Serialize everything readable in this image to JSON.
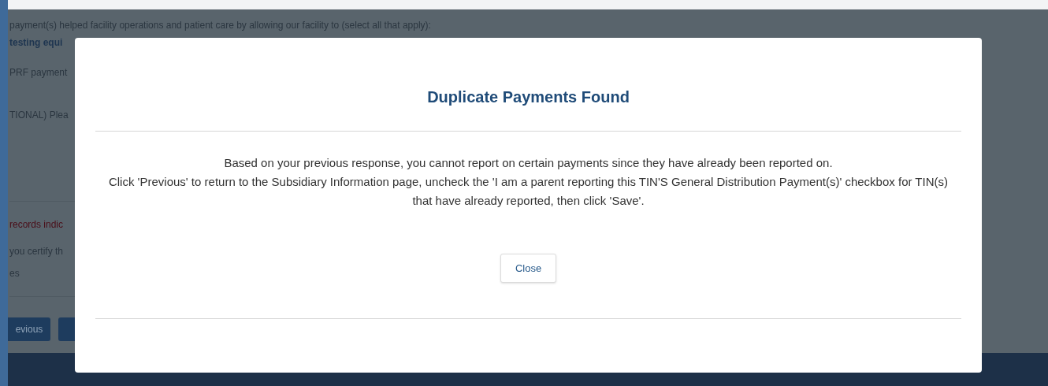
{
  "background_page": {
    "question": "payment(s) helped facility operations and patient care by allowing our facility to (select all that apply):",
    "selected_option": "testing equi",
    "lines": [
      {
        "kind": "plain",
        "text": "PRF payment"
      },
      {
        "kind": "plain",
        "text": "TIONAL) Plea"
      },
      {
        "kind": "rule"
      },
      {
        "kind": "warning",
        "text": "records indic"
      },
      {
        "kind": "plain",
        "text": "you certify th"
      },
      {
        "kind": "plain",
        "text": "es"
      }
    ],
    "previous_button": "evious"
  },
  "modal": {
    "title": "Duplicate Payments Found",
    "message": [
      "Based on your previous response, you cannot report on certain payments since they have already been reported on.",
      "Click 'Previous' to return to the Subsidiary Information page, uncheck the 'I am a parent reporting this TIN'S General Distribution Payment(s)' checkbox for TIN(s) that have already reported, then click 'Save'."
    ],
    "close_button": "Close"
  }
}
